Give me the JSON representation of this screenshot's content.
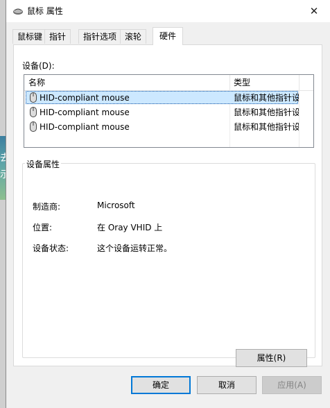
{
  "window": {
    "title": "鼠标 属性",
    "close_glyph": "✕"
  },
  "tabs": [
    {
      "label": "鼠标键"
    },
    {
      "label": "指针"
    },
    {
      "label": "指针选项"
    },
    {
      "label": "滚轮"
    },
    {
      "label": "硬件"
    }
  ],
  "active_tab": "硬件",
  "devices": {
    "label": "设备(D):",
    "columns": {
      "name": "名称",
      "type": "类型"
    },
    "rows": [
      {
        "name": "HID-compliant mouse",
        "type": "鼠标和其他指针设备"
      },
      {
        "name": "HID-compliant mouse",
        "type": "鼠标和其他指针设备"
      },
      {
        "name": "HID-compliant mouse",
        "type": "鼠标和其他指针设备"
      }
    ]
  },
  "device_properties": {
    "group_title": "设备属性",
    "manufacturer_label": "制造商:",
    "manufacturer_value": "Microsoft",
    "location_label": "位置:",
    "location_value": "在 Oray VHID 上",
    "status_label": "设备状态:",
    "status_value": "这个设备运转正常。",
    "properties_button": "属性(R)"
  },
  "buttons": {
    "ok": "确定",
    "cancel": "取消",
    "apply": "应用(A)"
  },
  "background_glyphs": [
    "去",
    "示"
  ],
  "colors": {
    "selection": "#cce8ff",
    "accent": "#0078d7"
  }
}
